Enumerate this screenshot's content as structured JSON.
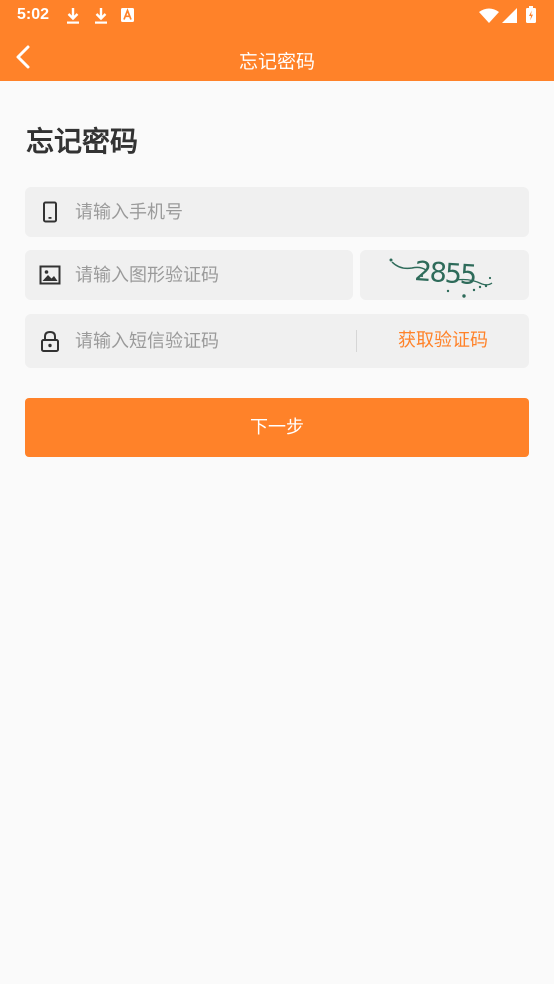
{
  "status_bar": {
    "time": "5:02",
    "left_icons": [
      "download-icon",
      "download-icon",
      "text-notification-icon"
    ],
    "right_icons": [
      "wifi-icon",
      "signal-icon",
      "battery-charging-icon"
    ]
  },
  "app_bar": {
    "back_icon": "chevron-left-icon",
    "title": "忘记密码"
  },
  "page": {
    "heading": "忘记密码"
  },
  "form": {
    "phone": {
      "icon": "phone-icon",
      "value": "",
      "placeholder": "请输入手机号"
    },
    "image_code": {
      "icon": "image-icon",
      "value": "",
      "placeholder": "请输入图形验证码"
    },
    "captcha": {
      "text": "2855"
    },
    "sms_code": {
      "icon": "lock-icon",
      "value": "",
      "placeholder": "请输入短信验证码"
    },
    "get_code_label": "获取验证码",
    "next_label": "下一步"
  },
  "colors": {
    "primary": "#ff8229",
    "background": "#fafafa",
    "field": "#f0f0f0",
    "heading": "#333333",
    "placeholder": "#9a9a9a",
    "captcha_ink": "#2e6b5a"
  }
}
